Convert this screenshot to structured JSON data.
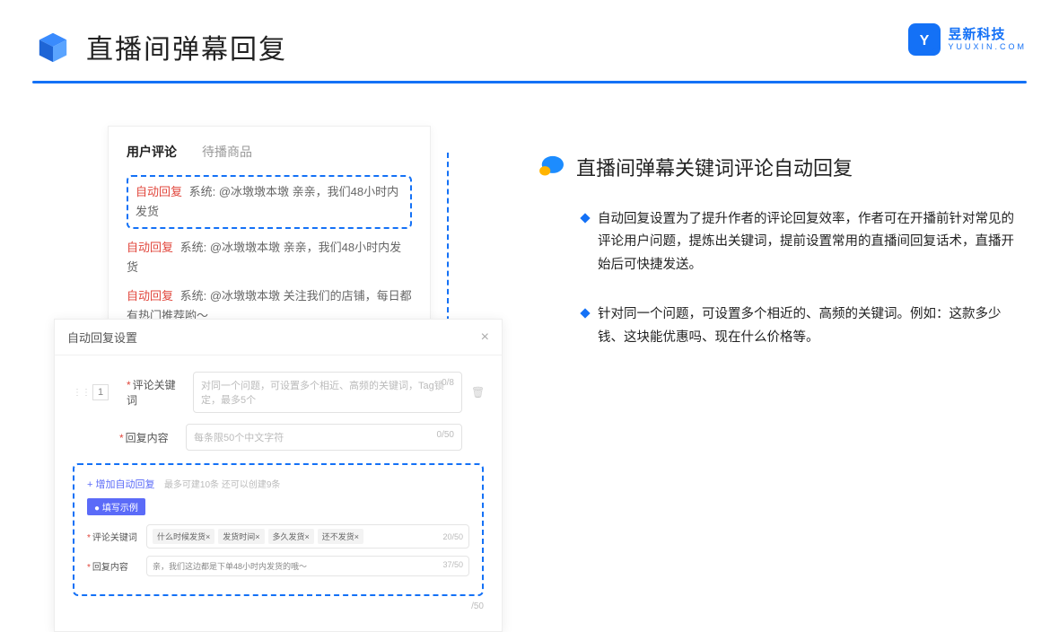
{
  "header": {
    "title": "直播间弹幕回复",
    "brand_cn": "昱新科技",
    "brand_en": "YUUXIN.COM"
  },
  "comments": {
    "tab_active": "用户评论",
    "tab_inactive": "待播商品",
    "row1_tag": "自动回复",
    "row1_text": "系统: @冰墩墩本墩 亲亲，我们48小时内发货",
    "row2_tag": "自动回复",
    "row2_text": "系统: @冰墩墩本墩 亲亲，我们48小时内发货",
    "row3_tag": "自动回复",
    "row3_text": "系统: @冰墩墩本墩 关注我们的店铺，每日都有热门推荐哟～"
  },
  "settings": {
    "title": "自动回复设置",
    "index": "1",
    "label_keyword": "评论关键词",
    "placeholder_keyword": "对同一个问题，可设置多个相近、高频的关键词，Tag锁定，最多5个",
    "counter_keyword": "0/8",
    "label_reply": "回复内容",
    "placeholder_reply": "每条限50个中文字符",
    "counter_reply": "0/50",
    "add_link": "+ 增加自动回复",
    "add_hint": "最多可建10条 还可以创建9条",
    "example_badge": "● 填写示例",
    "ex_label_keyword": "评论关键词",
    "ex_chip1": "什么时候发货×",
    "ex_chip2": "发货时间×",
    "ex_chip3": "多久发货×",
    "ex_chip4": "还不发货×",
    "ex_counter_keyword": "20/50",
    "ex_label_reply": "回复内容",
    "ex_reply_text": "亲，我们这边都是下单48小时内发货的哦～",
    "ex_counter_reply": "37/50",
    "footer_counter": "/50"
  },
  "right": {
    "section_title": "直播间弹幕关键词评论自动回复",
    "bullet1": "自动回复设置为了提升作者的评论回复效率，作者可在开播前针对常见的评论用户问题，提炼出关键词，提前设置常用的直播间回复话术，直播开始后可快捷发送。",
    "bullet2": "针对同一个问题，可设置多个相近的、高频的关键词。例如：这款多少钱、这块能优惠吗、现在什么价格等。"
  }
}
